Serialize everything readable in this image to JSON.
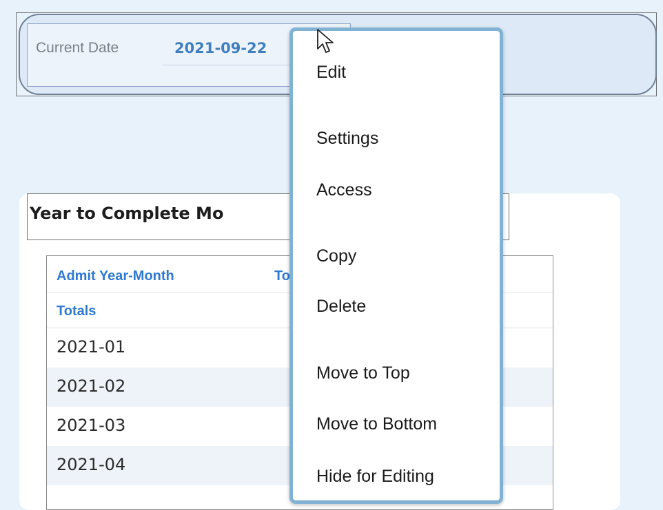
{
  "date_panel": {
    "label": "Current Date",
    "value": "2021-09-22"
  },
  "report": {
    "title": "Year to Complete Mo",
    "columns": {
      "admit_year_month": "Admit Year-Month",
      "total_partial": "To"
    },
    "totals_label": "Totals",
    "rows": [
      "2021-01",
      "2021-02",
      "2021-03",
      "2021-04"
    ]
  },
  "context_menu": {
    "items": [
      "Edit",
      "Settings",
      "Access",
      "Copy",
      "Delete",
      "Move to Top",
      "Move to Bottom",
      "Hide for Editing"
    ]
  },
  "icons": {
    "cursor": "mouse-pointer-icon"
  },
  "colors": {
    "accent_blue": "#2f7ad1",
    "menu_border": "#7fb2d3",
    "background": "#e7f2fb"
  }
}
